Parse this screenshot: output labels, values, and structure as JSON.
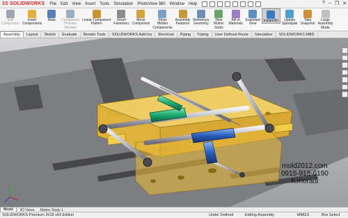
{
  "app": {
    "logo_brand": "3S",
    "logo_name": "SOLIDWORKS"
  },
  "menu": [
    "File",
    "Edit",
    "View",
    "Insert",
    "Tools",
    "Simulation",
    "PhotoView 360",
    "Window",
    "Help"
  ],
  "ribbon": [
    {
      "label": "Edit\nComponent",
      "color": "#9aa6b2",
      "dim": true
    },
    {
      "label": "Insert\nComponents",
      "color": "#e2b13b",
      "dim": false
    },
    {
      "label": "Mate",
      "color": "#5a7fb8",
      "dim": false
    },
    {
      "label": "Component\nPreview\nWindow",
      "color": "#9ab0c4",
      "dim": true
    },
    {
      "label": "Linear Component\nPattern",
      "color": "#c8952f",
      "dim": false
    },
    {
      "label": "Smart\nFasteners",
      "color": "#8c8c8c",
      "dim": false
    },
    {
      "label": "Move\nComponent",
      "color": "#d4a23a",
      "dim": false
    },
    {
      "label": "Show\nHidden\nComponents",
      "color": "#7ea0c4",
      "dim": false
    },
    {
      "label": "Assembly\nFeatures",
      "color": "#c89a3a",
      "dim": false
    },
    {
      "label": "Reference\nGeometry",
      "color": "#6f8fb4",
      "dim": false
    },
    {
      "label": "New\nMotion\nStudy",
      "color": "#6aa46a",
      "dim": false
    },
    {
      "label": "Bill of\nMaterials",
      "color": "#a07dc0",
      "dim": false
    },
    {
      "label": "Exploded\nView",
      "color": "#5f8fbf",
      "dim": false
    },
    {
      "label": "Instant3D",
      "color": "#3b7bbf",
      "dim": false,
      "active": true
    },
    {
      "label": "Update\nSpeedpak",
      "color": "#4f9fd0",
      "dim": false
    },
    {
      "label": "Take\nSnapshot",
      "color": "#d0903a",
      "dim": false
    },
    {
      "label": "Large\nAssembly\nMode",
      "color": "#c0c0c0",
      "dim": false
    }
  ],
  "tabs": [
    "Assembly",
    "Layout",
    "Sketch",
    "Evaluate",
    "Render Tools",
    "SOLIDWORKS Add-Ins",
    "Electrical",
    "Piping",
    "Tubing",
    "User Defined Route",
    "Simulation",
    "SOLIDWORKS MBD"
  ],
  "active_tab": "Assembly",
  "bottom_tabs": [
    "Model",
    "3D Views",
    "Motion Study 1"
  ],
  "watermark": {
    "line1": "mold2012.com",
    "line2": "0915-918-6190",
    "line3": "h.moradi"
  },
  "status": {
    "left": "SOLIDWORKS Premium 2018 x64 Edition",
    "defined": "Under Defined",
    "mode": "Editing Assembly",
    "units": "MMGS",
    "select": "Box Select"
  },
  "colors": {
    "mold_plate": "#8a8a8a",
    "insert_block": "#f0c040",
    "green_sleeve": "#1ea870",
    "blue_sleeve": "#2a5fc0",
    "rod": "#c8c8cc"
  }
}
